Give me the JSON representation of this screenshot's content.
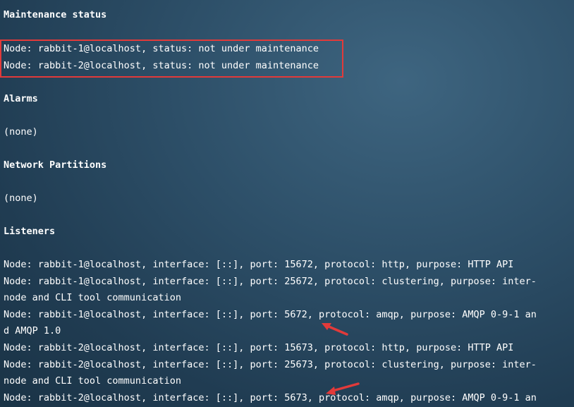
{
  "sections": {
    "maintenance": {
      "heading": "Maintenance status",
      "lines": [
        "Node: rabbit-1@localhost, status: not under maintenance",
        "Node: rabbit-2@localhost, status: not under maintenance"
      ]
    },
    "alarms": {
      "heading": "Alarms",
      "value": "(none)"
    },
    "network_partitions": {
      "heading": "Network Partitions",
      "value": "(none)"
    },
    "listeners": {
      "heading": "Listeners",
      "lines": [
        "Node: rabbit-1@localhost, interface: [::], port: 15672, protocol: http, purpose: HTTP API",
        "Node: rabbit-1@localhost, interface: [::], port: 25672, protocol: clustering, purpose: inter-",
        "node and CLI tool communication",
        "Node: rabbit-1@localhost, interface: [::], port: 5672, protocol: amqp, purpose: AMQP 0-9-1 an",
        "d AMQP 1.0",
        "Node: rabbit-2@localhost, interface: [::], port: 15673, protocol: http, purpose: HTTP API",
        "Node: rabbit-2@localhost, interface: [::], port: 25673, protocol: clustering, purpose: inter-",
        "node and CLI tool communication",
        "Node: rabbit-2@localhost, interface: [::], port: 5673, protocol: amqp, purpose: AMQP 0-9-1 an"
      ]
    }
  },
  "colors": {
    "highlight_border": "#e23a3a",
    "arrow": "#e23a3a",
    "text": "#ffffff"
  }
}
